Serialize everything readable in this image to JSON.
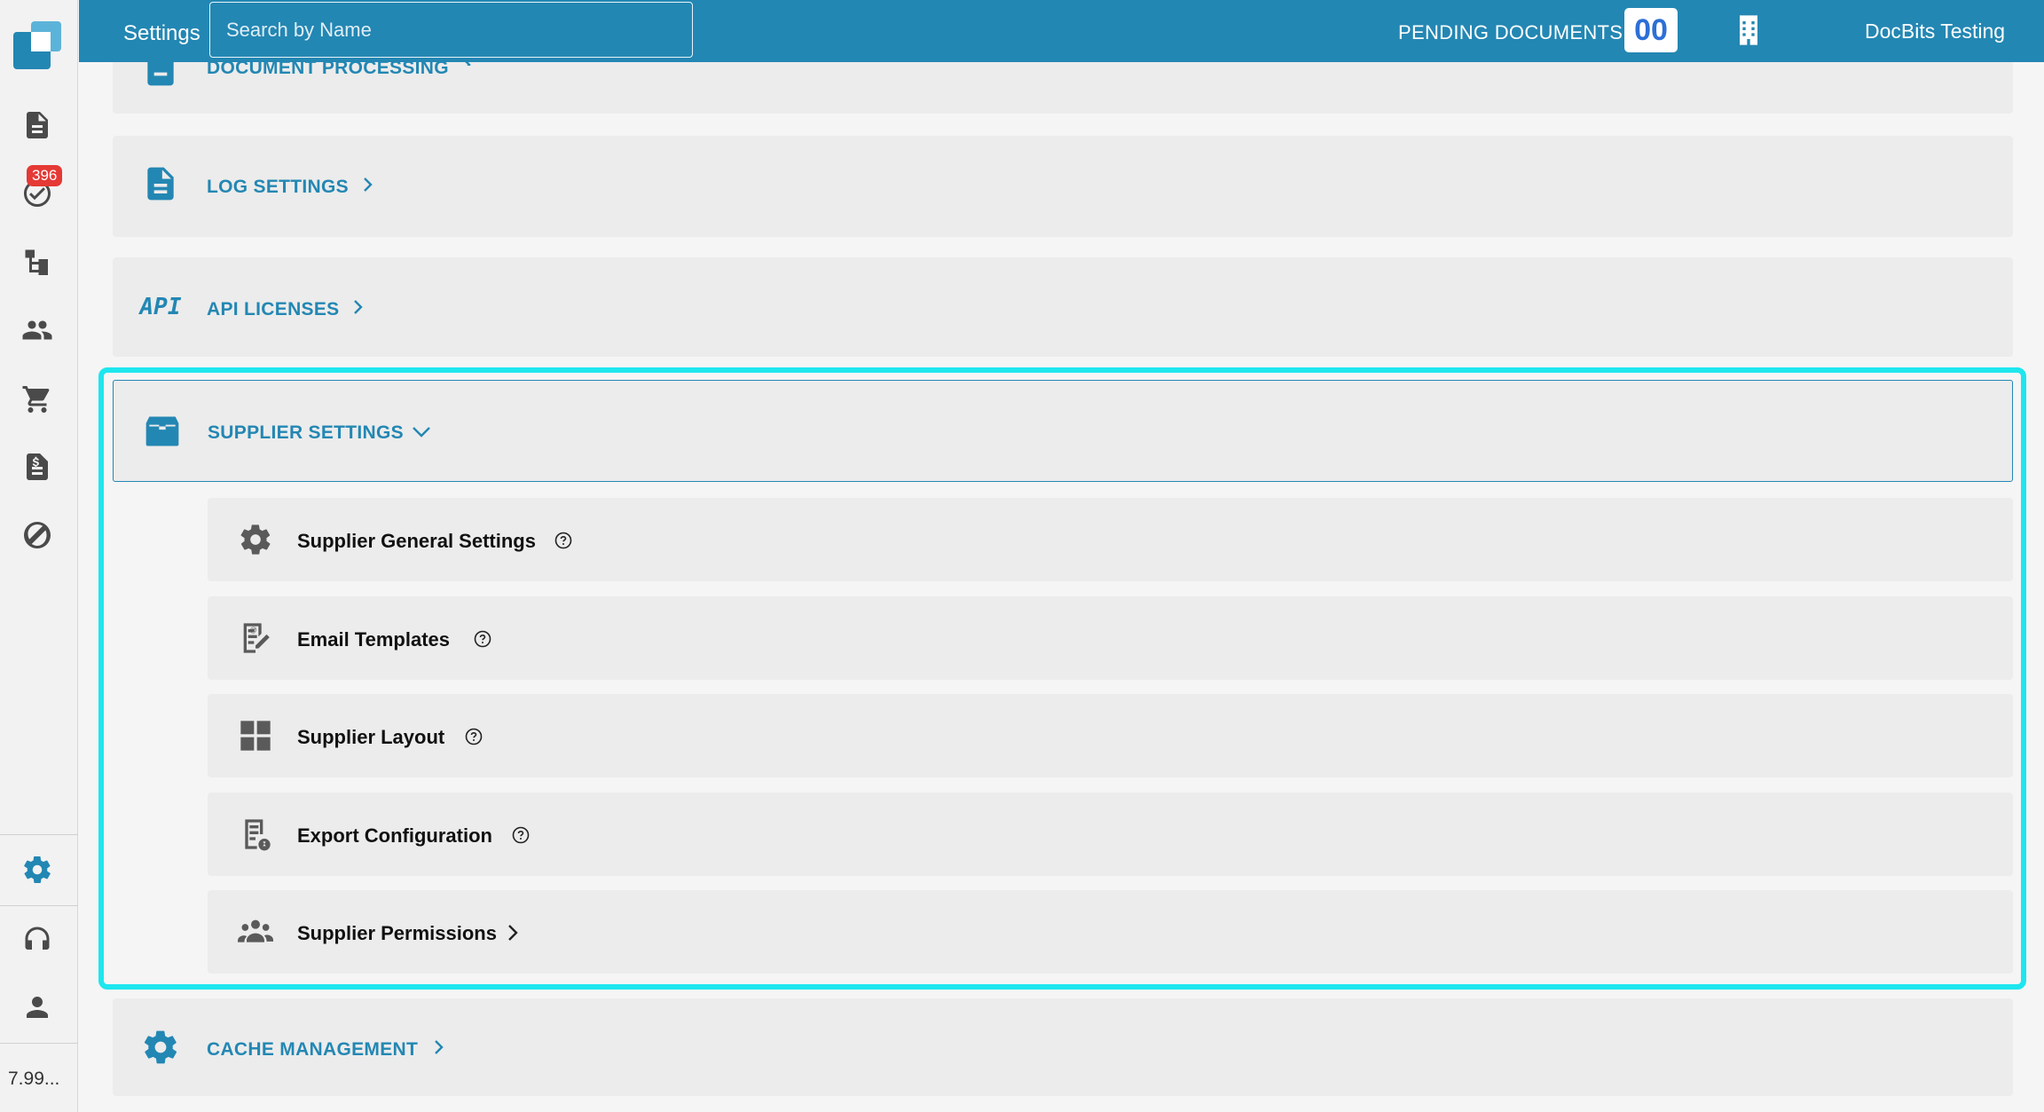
{
  "header": {
    "title": "Settings",
    "search_placeholder": "Search by Name",
    "pending_label": "PENDING DOCUMENTS:",
    "pending_count": "00",
    "organization": "DocBits Testing"
  },
  "sidebar": {
    "badge_count": "396",
    "version": "7.99...",
    "icons": [
      "documents-icon",
      "tasks-icon",
      "workflow-icon",
      "users-icon",
      "cart-icon",
      "invoice-icon",
      "integration-icon",
      "settings-icon",
      "support-icon",
      "account-icon"
    ]
  },
  "sections": {
    "document_processing": "DOCUMENT PROCESSING",
    "log_settings": "LOG SETTINGS",
    "api_badge": "API",
    "api_licenses": "API LICENSES",
    "supplier_settings": "SUPPLIER SETTINGS",
    "cache_management": "CACHE MANAGEMENT"
  },
  "supplier_items": [
    {
      "label": "Supplier General Settings",
      "icon": "gear-icon"
    },
    {
      "label": "Email Templates",
      "icon": "email-template-icon"
    },
    {
      "label": "Supplier Layout",
      "icon": "layout-grid-icon"
    },
    {
      "label": "Export Configuration",
      "icon": "export-config-icon"
    },
    {
      "label": "Supplier Permissions",
      "icon": "group-icon"
    }
  ],
  "colors": {
    "primary": "#2387b3",
    "highlight": "#1ee6ee",
    "badge": "#e53935"
  }
}
